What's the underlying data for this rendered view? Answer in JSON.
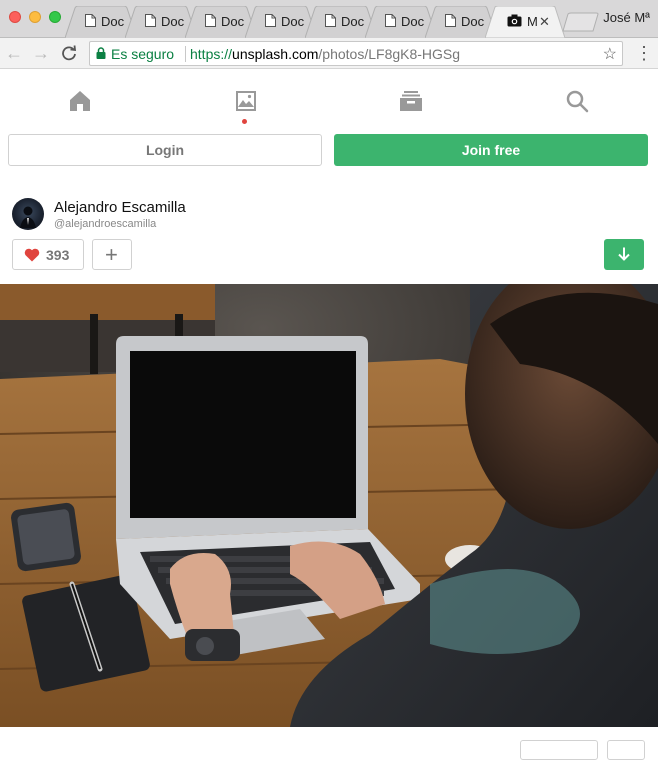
{
  "browser": {
    "tabs": [
      {
        "label": "Doc"
      },
      {
        "label": "Doc"
      },
      {
        "label": "Doc"
      },
      {
        "label": "Doc"
      },
      {
        "label": "Doc"
      },
      {
        "label": "Doc"
      },
      {
        "label": "Doc"
      }
    ],
    "active_tab": {
      "label": "M",
      "close": "✕"
    },
    "profile_name": "José Mª",
    "address": {
      "security_label": "Es seguro",
      "url_protocol": "https://",
      "url_host": "unsplash.com",
      "url_path": "/photos/LF8gK8-HGSg"
    }
  },
  "site_nav": {
    "items": [
      {
        "icon": "home-icon"
      },
      {
        "icon": "photos-icon",
        "active": true
      },
      {
        "icon": "collections-icon"
      },
      {
        "icon": "search-icon"
      }
    ]
  },
  "auth": {
    "login_label": "Login",
    "join_label": "Join free"
  },
  "author": {
    "name": "Alejandro Escamilla",
    "handle": "@alejandroescamilla"
  },
  "actions": {
    "likes": "393",
    "add_symbol": "+"
  },
  "photo": {
    "subject": "laptop-on-wooden-desk"
  },
  "colors": {
    "brand_green": "#3cb46e",
    "secure_green": "#0b8043",
    "like_red": "#e0443e"
  }
}
